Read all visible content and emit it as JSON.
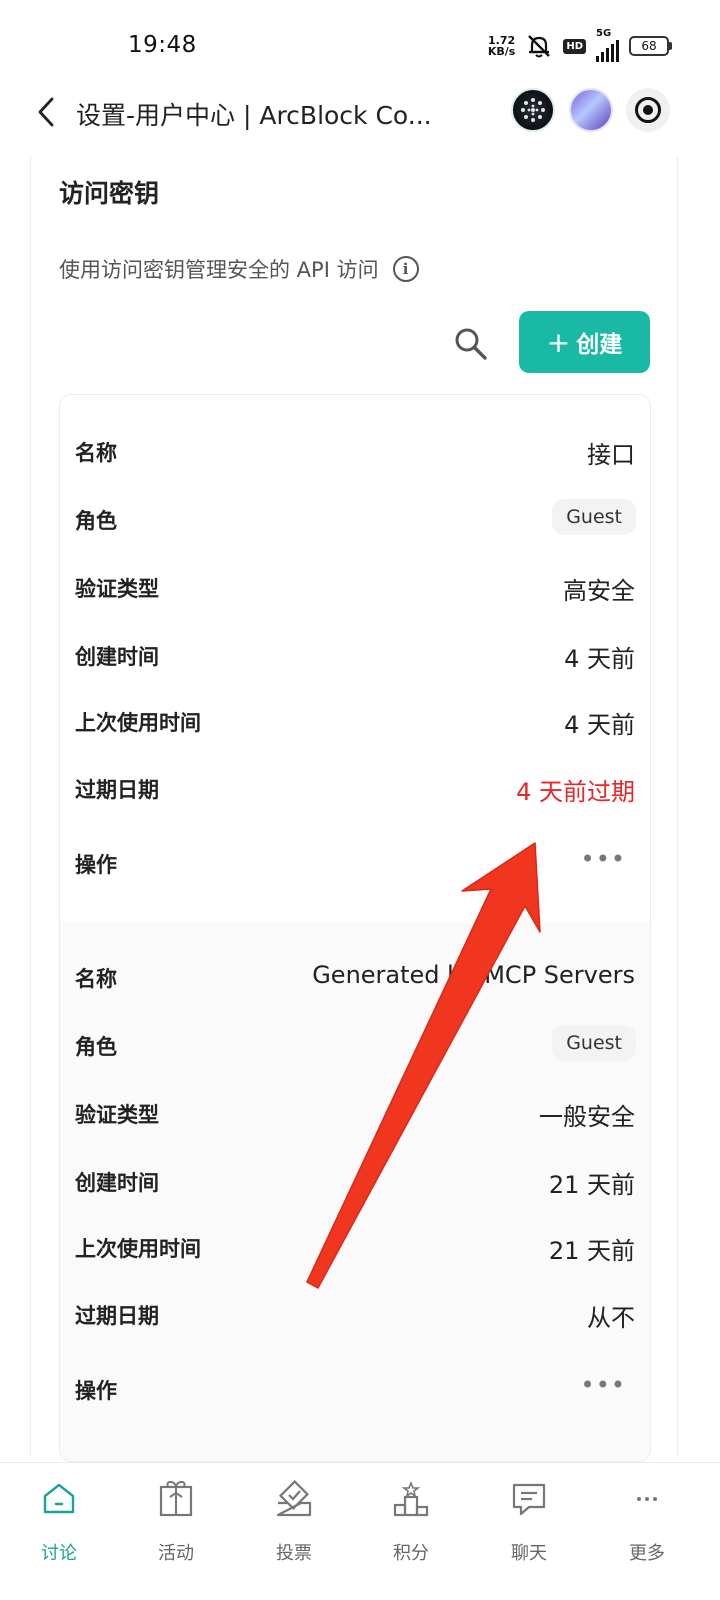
{
  "status_bar": {
    "time": "19:48",
    "net_speed_value": "1.72",
    "net_speed_unit": "KB/s",
    "hd": "HD",
    "network": "5G",
    "battery": "68"
  },
  "nav": {
    "title": "设置-用户中心 | ArcBlock Co..."
  },
  "section": {
    "title": "访问密钥",
    "description": "使用访问密钥管理安全的 API 访问",
    "info_icon_char": "i",
    "create_label": "创建",
    "create_plus": "+"
  },
  "labels": {
    "name": "名称",
    "role": "角色",
    "auth_type": "验证类型",
    "created": "创建时间",
    "last_used": "上次使用时间",
    "expires": "过期日期",
    "actions": "操作"
  },
  "keys": [
    {
      "name": "接口",
      "role": "Guest",
      "auth_type": "高安全",
      "created": "4 天前",
      "last_used": "4 天前",
      "expires": "4 天前过期",
      "actions": "•••"
    },
    {
      "name": "Generated by MCP Servers",
      "role": "Guest",
      "auth_type": "一般安全",
      "created": "21 天前",
      "last_used": "21 天前",
      "expires": "从不",
      "actions": "•••"
    }
  ],
  "colors": {
    "accent": "#19b9a6",
    "danger": "#e5262b",
    "annotation": "#f0361f"
  },
  "tabs": [
    {
      "label": "讨论",
      "icon": "home-icon",
      "active": true
    },
    {
      "label": "活动",
      "icon": "gift-icon",
      "active": false
    },
    {
      "label": "投票",
      "icon": "vote-icon",
      "active": false
    },
    {
      "label": "积分",
      "icon": "podium-icon",
      "active": false
    },
    {
      "label": "聊天",
      "icon": "chat-icon",
      "active": false
    },
    {
      "label": "更多",
      "icon": "more-icon",
      "active": false
    }
  ]
}
